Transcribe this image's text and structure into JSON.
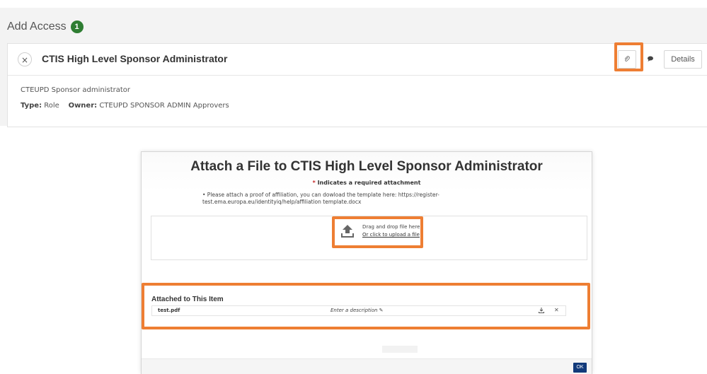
{
  "section": {
    "title": "Add Access",
    "count": "1"
  },
  "role_card": {
    "remove_icon": "×",
    "title": "CTIS High Level Sponsor Administrator",
    "description": "CTEUPD Sponsor administrator",
    "type_label": "Type:",
    "type_value": "Role",
    "owner_label": "Owner:",
    "owner_value": "CTEUPD SPONSOR ADMIN Approvers",
    "attach_icon": "paperclip-icon",
    "comment_icon": "comment-icon",
    "details_label": "Details"
  },
  "modal": {
    "title": "Attach a File to CTIS High Level Sponsor Administrator",
    "required_star": "*",
    "required_note": "Indicates a required attachment",
    "instructions": "• Please attach a proof of affiliation, you can dowload the template here: https://register-test.ema.europa.eu/identityiq/help/affiliation template.docx",
    "drop_text": "Drag and drop file here",
    "upload_link": "Or click to upload a file",
    "attached_title": "Attached to This Item",
    "attachments": [
      {
        "file_name": "test.pdf",
        "description_placeholder": "Enter a description ✎"
      }
    ],
    "ok_label": "OK"
  },
  "colors": {
    "highlight": "#ee7e33",
    "badge": "#2e7d32",
    "ok_button": "#123a7a",
    "required_star": "#c62828"
  }
}
